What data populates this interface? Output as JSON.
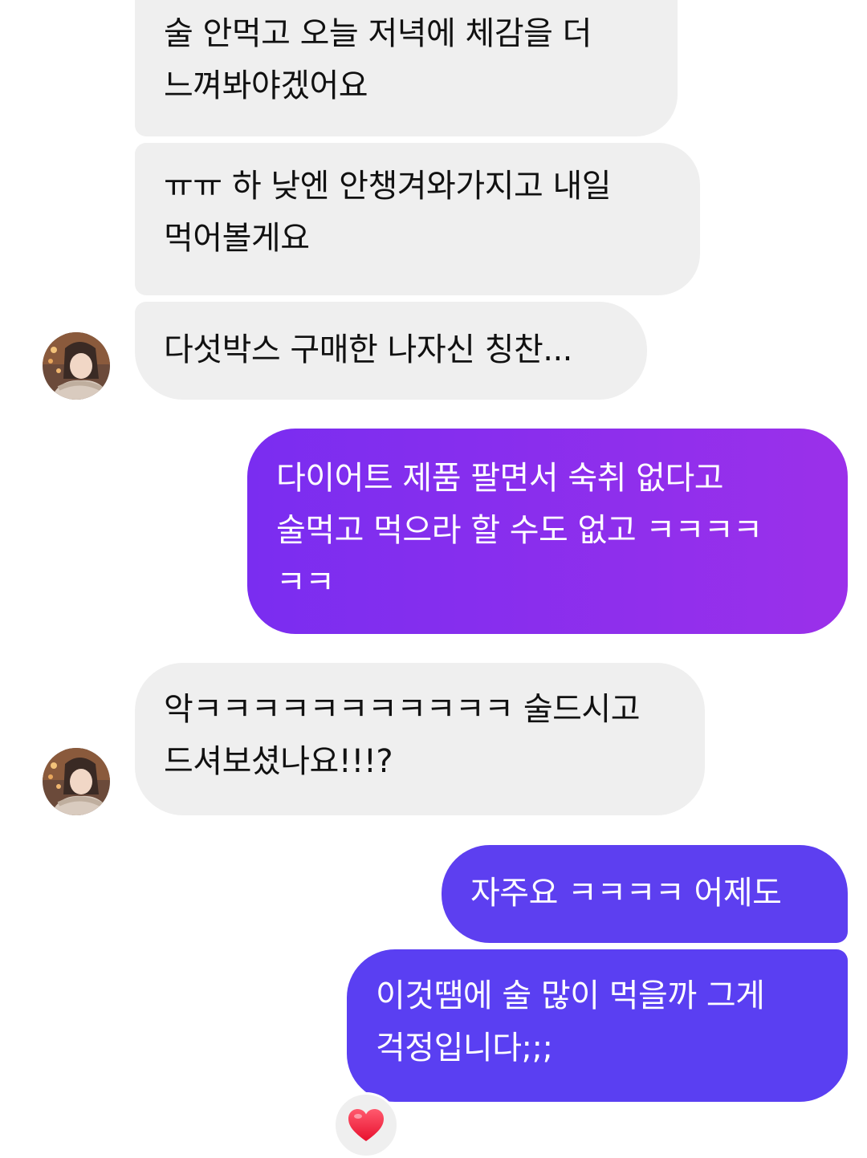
{
  "messages": [
    {
      "direction": "incoming",
      "text": "술 안먹고 오늘 저녁에 체감을 더\n느껴봐야겠어요"
    },
    {
      "direction": "incoming",
      "text": "ㅠㅠ 하 낮엔 안챙겨와가지고 내일\n먹어볼게요"
    },
    {
      "direction": "incoming",
      "text": "다섯박스 구매한 나자신 칭찬..."
    },
    {
      "direction": "outgoing",
      "text": "다이어트 제품 팔면서 숙취 없다고\n술먹고 먹으라 할 수도 없고 ㅋㅋㅋㅋ\nㅋㅋ"
    },
    {
      "direction": "incoming",
      "text": "악ㅋㅋㅋㅋㅋㅋㅋㅋㅋㅋㅋ 술드시고\n드셔보셨나요!!!?"
    },
    {
      "direction": "outgoing",
      "text": "자주요 ㅋㅋㅋㅋ 어제도"
    },
    {
      "direction": "outgoing",
      "text": "이것땜에 술 많이 먹을까 그게\n걱정입니다;;;"
    }
  ],
  "reaction": {
    "icon": "heart-icon",
    "color": "#ff2d55"
  },
  "colors": {
    "incoming_bubble": "#efefef",
    "outgoing_gradient_start": "#7a2df0",
    "outgoing_gradient_end": "#9b30ea",
    "outgoing_bubble": "#5d3ff0"
  }
}
